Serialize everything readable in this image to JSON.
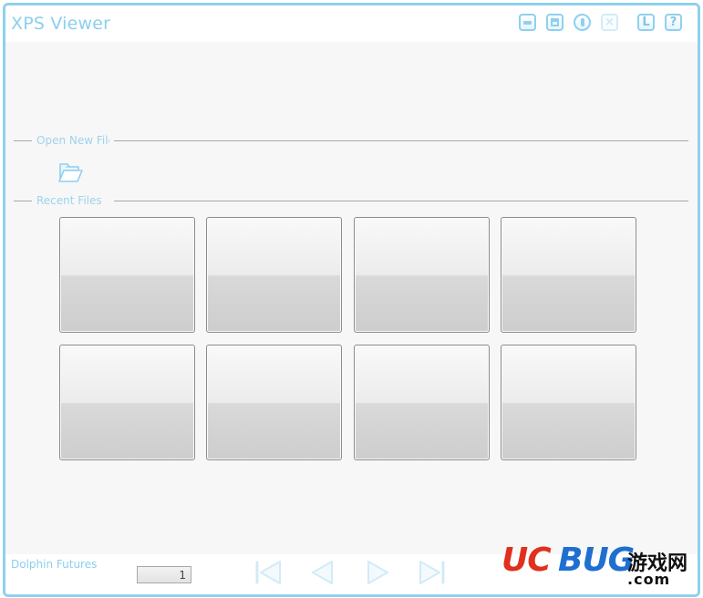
{
  "window": {
    "title": "XPS Viewer",
    "accent_color": "#8fd0ee"
  },
  "titlebar_buttons": [
    {
      "name": "minimize",
      "icon": "minimize-icon",
      "label": ""
    },
    {
      "name": "maximize",
      "icon": "maximize-icon",
      "label": ""
    },
    {
      "name": "pause",
      "icon": "pause-icon",
      "label": ""
    },
    {
      "name": "close",
      "icon": "close-icon",
      "label": "×",
      "disabled": true
    },
    {
      "name": "language",
      "icon": "language-icon",
      "label": "L"
    },
    {
      "name": "help",
      "icon": "help-icon",
      "label": "?"
    }
  ],
  "sections": {
    "open_new_file": {
      "label": "Open New File",
      "icon": "open-folder-icon"
    },
    "recent_files": {
      "label": "Recent Files",
      "tile_count": 8
    }
  },
  "status": {
    "company": "Dolphin Futures",
    "page_number": "1",
    "nav_buttons": [
      "first-page-icon",
      "previous-page-icon",
      "next-page-icon",
      "last-page-icon"
    ]
  },
  "watermark": {
    "uc": "UC",
    "bug": "BUG",
    "cn": "游戏网",
    "com": ".com"
  }
}
